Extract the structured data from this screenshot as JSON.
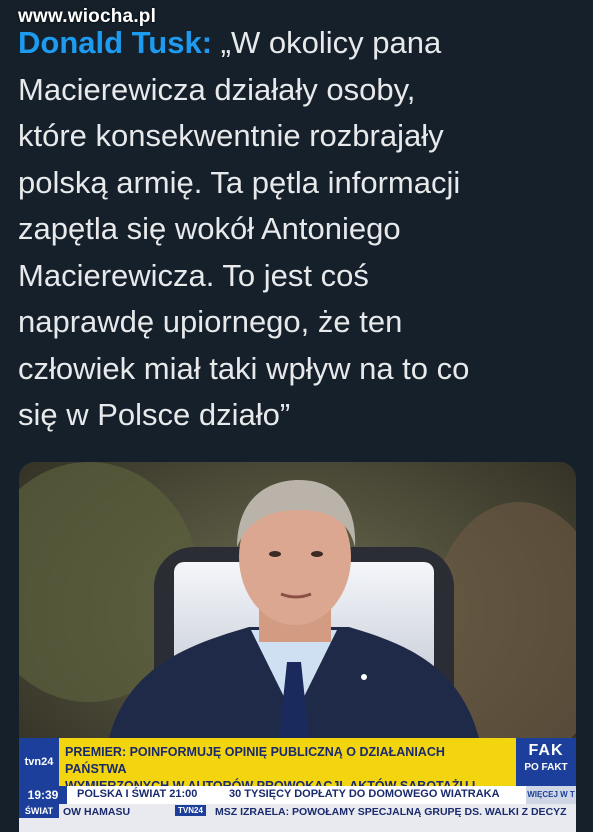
{
  "watermark": "www.wiocha.pl",
  "tweet": {
    "author": "Donald Tusk:",
    "lines": [
      "„W okolicy pana",
      "Macierewicza działały osoby,",
      "które konsekwentnie rozbrajały",
      "polską armię. Ta pętla informacji",
      "zapętla się wokół Antoniego",
      "Macierewicza. To jest coś",
      "naprawdę upiornego, że ten",
      "człowiek miał taki wpływ na to co",
      "się w Polsce działo”"
    ]
  },
  "tv": {
    "channel_logo": "tvn24",
    "headline_line1": "PREMIER: POINFORMUJĘ OPINIĘ PUBLICZNĄ O DZIAŁANIACH PAŃSTWA",
    "headline_line2": "WYMIERZONYCH W AUTORÓW PROWOKACJI, AKTÓW SABOTAŻU I DYWERSJI",
    "right_box_big": "FAK",
    "right_box_small": "PO FAKT",
    "clock": "19:39",
    "program": "POLSKA I ŚWIAT 21:00",
    "info": "30 TYSIĘCY DOPŁATY DO DOMOWEGO WIATRAKA",
    "more": "WIĘCEJ W T",
    "bottom_tag": "ŚWIAT",
    "bottom_item1": "OW HAMASU",
    "bottom_brand": "TVN24",
    "bottom_item2": "MSZ IZRAELA: POWOŁAMY SPECJALNĄ GRUPĘ DS. WALKI Z DECYZ"
  },
  "colors": {
    "background": "#15202b",
    "text": "#e7e9ea",
    "author": "#1d9bf0",
    "ticker_yellow": "#f2d40f",
    "ticker_blue": "#1b3f9a"
  }
}
